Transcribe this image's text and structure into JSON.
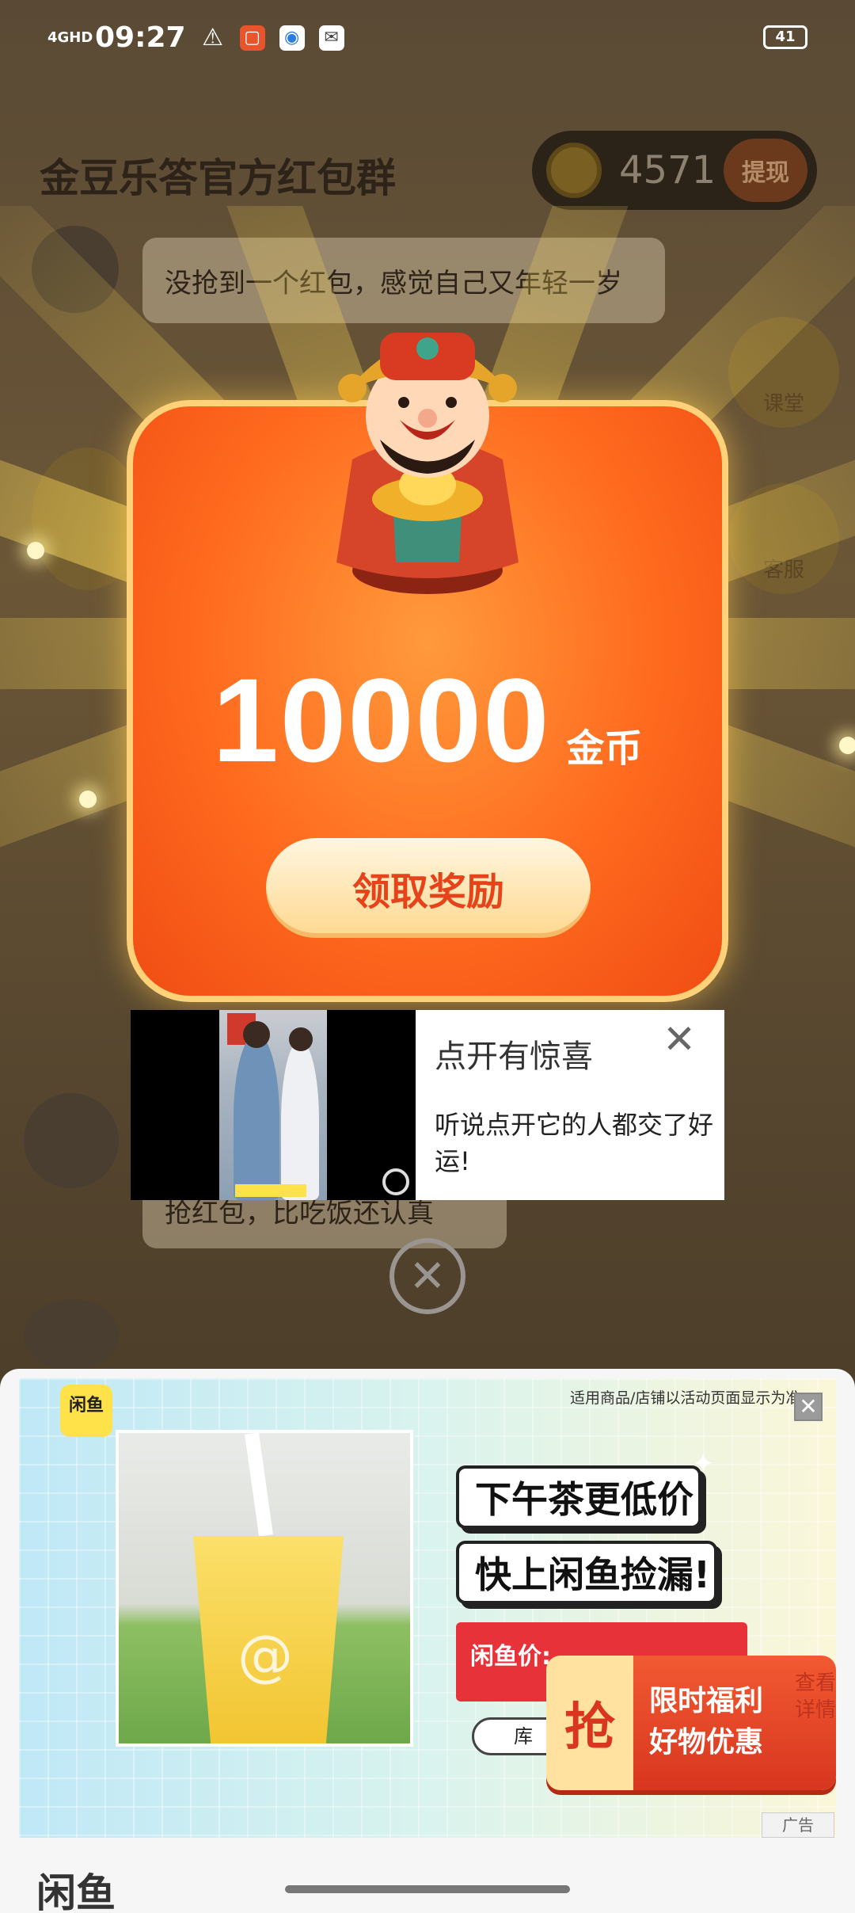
{
  "status_bar": {
    "network": "4GHD",
    "time": "09:27",
    "alert_icon": "⚠",
    "battery": "41"
  },
  "background_app": {
    "group_title": "金豆乐答官方红包群",
    "coin_balance": "4571",
    "withdraw_label": "提现",
    "chat_message_top": "没抢到一个红包，感觉自己又年轻一岁",
    "chat_message_bottom": "抢红包，比吃饭还认真",
    "side_icon_1": "课堂",
    "side_icon_2": "客服"
  },
  "reward_popup": {
    "amount": "10000",
    "unit": "金币",
    "claim_label": "领取奖励"
  },
  "video_ad": {
    "title": "点开有惊喜",
    "description": "听说点开它的人都交了好运!",
    "close_glyph": "✕"
  },
  "popup_close_glyph": "✕",
  "banner_ad": {
    "brand": "闲鱼",
    "disclaimer": "适用商品/店铺以活动页面显示为准",
    "close_glyph": "✕",
    "slogan_1": "下午茶更低价",
    "slogan_2": "快上闲鱼捡漏!",
    "price_label": "闲鱼价:",
    "stock_label": "库",
    "promo_grab": "抢",
    "promo_line_1": "限时福利",
    "promo_line_2": "好物优惠",
    "promo_side": "查看详情",
    "ad_tag": "广告"
  },
  "sheet_title": "闲鱼",
  "colors": {
    "reward_orange": "#ff6a1e",
    "claim_text": "#e6431a",
    "brand_yellow": "#ffe14a",
    "price_red": "#e8323a"
  }
}
